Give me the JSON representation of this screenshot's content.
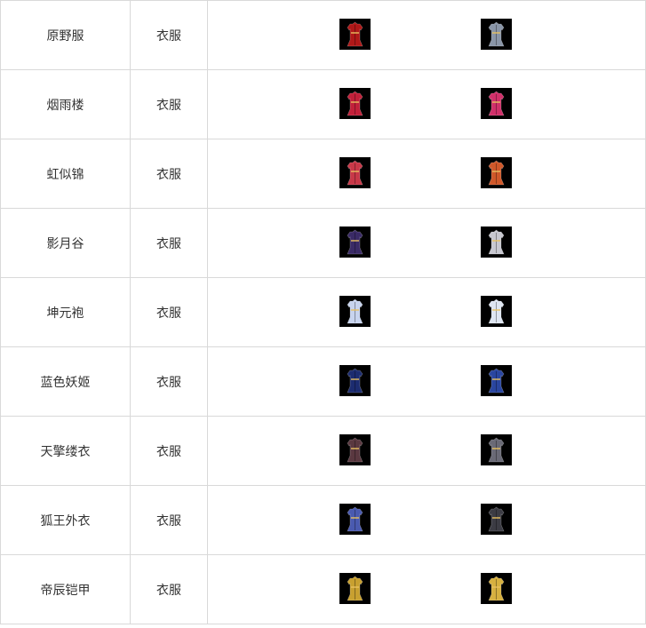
{
  "table": {
    "rows": [
      {
        "name": "原野服",
        "type": "衣服",
        "icons": [
          "male-robe-red-icon",
          "female-robe-grey-icon"
        ],
        "colors": [
          "#b01818",
          "#8a96a8"
        ]
      },
      {
        "name": "烟雨楼",
        "type": "衣服",
        "icons": [
          "male-robe-crimson-icon",
          "female-robe-pink-icon"
        ],
        "colors": [
          "#c2203a",
          "#d0306a"
        ]
      },
      {
        "name": "虹似锦",
        "type": "衣服",
        "icons": [
          "male-robe-rose-icon",
          "female-robe-orange-icon"
        ],
        "colors": [
          "#c83848",
          "#d0582a"
        ]
      },
      {
        "name": "影月谷",
        "type": "衣服",
        "icons": [
          "male-robe-purple-icon",
          "female-robe-silver-icon"
        ],
        "colors": [
          "#3a2a66",
          "#c8c8d0"
        ]
      },
      {
        "name": "坤元袍",
        "type": "衣服",
        "icons": [
          "male-robe-white-icon",
          "female-robe-white-icon"
        ],
        "colors": [
          "#c8d4ee",
          "#dfe6f2"
        ]
      },
      {
        "name": "蓝色妖姬",
        "type": "衣服",
        "icons": [
          "male-robe-navy-icon",
          "female-robe-blue-icon"
        ],
        "colors": [
          "#1c2c70",
          "#2a46a0"
        ]
      },
      {
        "name": "天擎缕衣",
        "type": "衣服",
        "icons": [
          "male-robe-dark-icon",
          "female-robe-dark-icon"
        ],
        "colors": [
          "#5a3840",
          "#6a6a76"
        ]
      },
      {
        "name": "狐王外衣",
        "type": "衣服",
        "icons": [
          "male-robe-wings-icon",
          "female-robe-shadow-icon"
        ],
        "colors": [
          "#4a5ab0",
          "#3c3c44"
        ]
      },
      {
        "name": "帝辰铠甲",
        "type": "衣服",
        "icons": [
          "male-armor-gold-icon",
          "female-armor-gold-icon"
        ],
        "colors": [
          "#c8a030",
          "#d6b040"
        ]
      }
    ]
  }
}
